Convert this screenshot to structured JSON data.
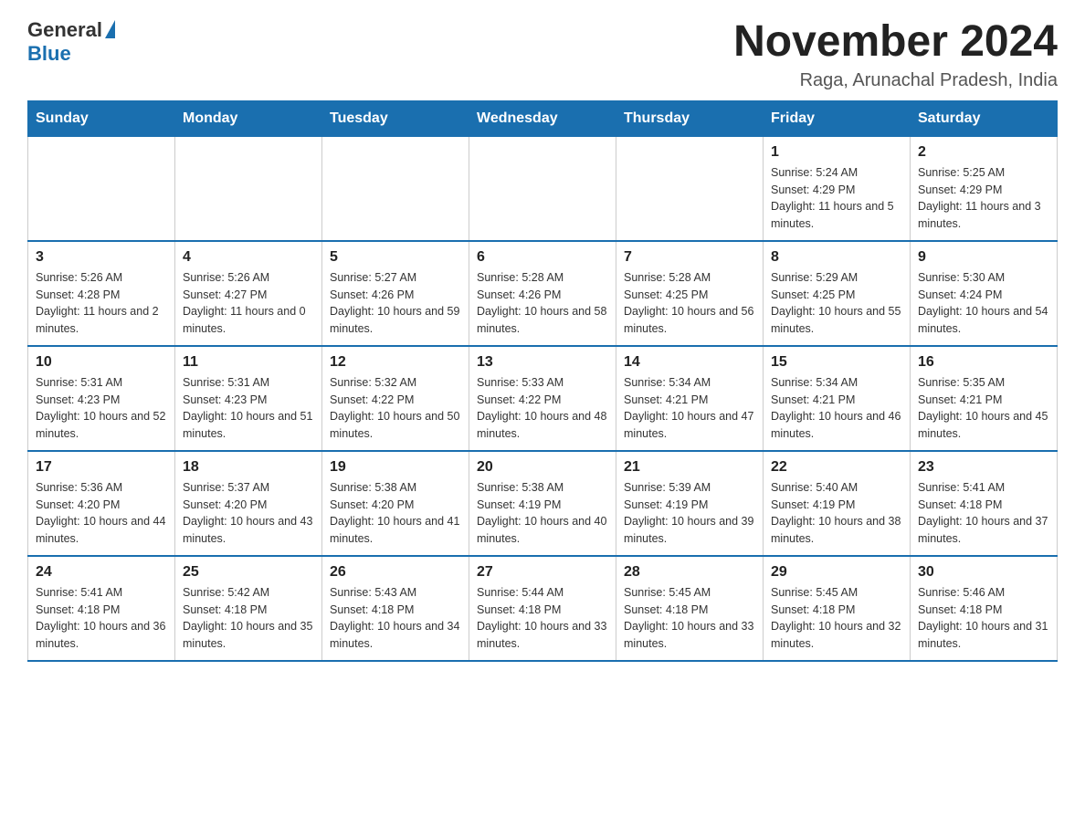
{
  "header": {
    "logo_general": "General",
    "logo_blue": "Blue",
    "month_title": "November 2024",
    "location": "Raga, Arunachal Pradesh, India"
  },
  "days_of_week": [
    "Sunday",
    "Monday",
    "Tuesday",
    "Wednesday",
    "Thursday",
    "Friday",
    "Saturday"
  ],
  "weeks": [
    [
      {
        "day": "",
        "info": ""
      },
      {
        "day": "",
        "info": ""
      },
      {
        "day": "",
        "info": ""
      },
      {
        "day": "",
        "info": ""
      },
      {
        "day": "",
        "info": ""
      },
      {
        "day": "1",
        "info": "Sunrise: 5:24 AM\nSunset: 4:29 PM\nDaylight: 11 hours and 5 minutes."
      },
      {
        "day": "2",
        "info": "Sunrise: 5:25 AM\nSunset: 4:29 PM\nDaylight: 11 hours and 3 minutes."
      }
    ],
    [
      {
        "day": "3",
        "info": "Sunrise: 5:26 AM\nSunset: 4:28 PM\nDaylight: 11 hours and 2 minutes."
      },
      {
        "day": "4",
        "info": "Sunrise: 5:26 AM\nSunset: 4:27 PM\nDaylight: 11 hours and 0 minutes."
      },
      {
        "day": "5",
        "info": "Sunrise: 5:27 AM\nSunset: 4:26 PM\nDaylight: 10 hours and 59 minutes."
      },
      {
        "day": "6",
        "info": "Sunrise: 5:28 AM\nSunset: 4:26 PM\nDaylight: 10 hours and 58 minutes."
      },
      {
        "day": "7",
        "info": "Sunrise: 5:28 AM\nSunset: 4:25 PM\nDaylight: 10 hours and 56 minutes."
      },
      {
        "day": "8",
        "info": "Sunrise: 5:29 AM\nSunset: 4:25 PM\nDaylight: 10 hours and 55 minutes."
      },
      {
        "day": "9",
        "info": "Sunrise: 5:30 AM\nSunset: 4:24 PM\nDaylight: 10 hours and 54 minutes."
      }
    ],
    [
      {
        "day": "10",
        "info": "Sunrise: 5:31 AM\nSunset: 4:23 PM\nDaylight: 10 hours and 52 minutes."
      },
      {
        "day": "11",
        "info": "Sunrise: 5:31 AM\nSunset: 4:23 PM\nDaylight: 10 hours and 51 minutes."
      },
      {
        "day": "12",
        "info": "Sunrise: 5:32 AM\nSunset: 4:22 PM\nDaylight: 10 hours and 50 minutes."
      },
      {
        "day": "13",
        "info": "Sunrise: 5:33 AM\nSunset: 4:22 PM\nDaylight: 10 hours and 48 minutes."
      },
      {
        "day": "14",
        "info": "Sunrise: 5:34 AM\nSunset: 4:21 PM\nDaylight: 10 hours and 47 minutes."
      },
      {
        "day": "15",
        "info": "Sunrise: 5:34 AM\nSunset: 4:21 PM\nDaylight: 10 hours and 46 minutes."
      },
      {
        "day": "16",
        "info": "Sunrise: 5:35 AM\nSunset: 4:21 PM\nDaylight: 10 hours and 45 minutes."
      }
    ],
    [
      {
        "day": "17",
        "info": "Sunrise: 5:36 AM\nSunset: 4:20 PM\nDaylight: 10 hours and 44 minutes."
      },
      {
        "day": "18",
        "info": "Sunrise: 5:37 AM\nSunset: 4:20 PM\nDaylight: 10 hours and 43 minutes."
      },
      {
        "day": "19",
        "info": "Sunrise: 5:38 AM\nSunset: 4:20 PM\nDaylight: 10 hours and 41 minutes."
      },
      {
        "day": "20",
        "info": "Sunrise: 5:38 AM\nSunset: 4:19 PM\nDaylight: 10 hours and 40 minutes."
      },
      {
        "day": "21",
        "info": "Sunrise: 5:39 AM\nSunset: 4:19 PM\nDaylight: 10 hours and 39 minutes."
      },
      {
        "day": "22",
        "info": "Sunrise: 5:40 AM\nSunset: 4:19 PM\nDaylight: 10 hours and 38 minutes."
      },
      {
        "day": "23",
        "info": "Sunrise: 5:41 AM\nSunset: 4:18 PM\nDaylight: 10 hours and 37 minutes."
      }
    ],
    [
      {
        "day": "24",
        "info": "Sunrise: 5:41 AM\nSunset: 4:18 PM\nDaylight: 10 hours and 36 minutes."
      },
      {
        "day": "25",
        "info": "Sunrise: 5:42 AM\nSunset: 4:18 PM\nDaylight: 10 hours and 35 minutes."
      },
      {
        "day": "26",
        "info": "Sunrise: 5:43 AM\nSunset: 4:18 PM\nDaylight: 10 hours and 34 minutes."
      },
      {
        "day": "27",
        "info": "Sunrise: 5:44 AM\nSunset: 4:18 PM\nDaylight: 10 hours and 33 minutes."
      },
      {
        "day": "28",
        "info": "Sunrise: 5:45 AM\nSunset: 4:18 PM\nDaylight: 10 hours and 33 minutes."
      },
      {
        "day": "29",
        "info": "Sunrise: 5:45 AM\nSunset: 4:18 PM\nDaylight: 10 hours and 32 minutes."
      },
      {
        "day": "30",
        "info": "Sunrise: 5:46 AM\nSunset: 4:18 PM\nDaylight: 10 hours and 31 minutes."
      }
    ]
  ]
}
